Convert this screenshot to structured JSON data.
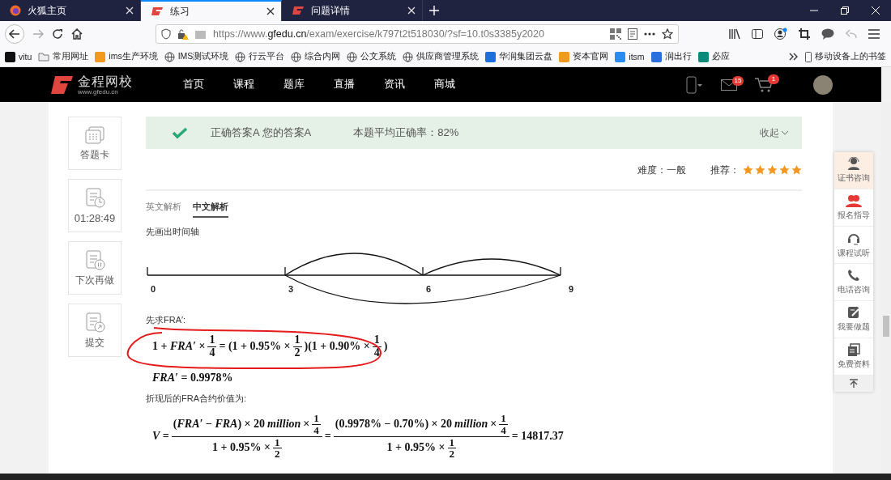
{
  "browser": {
    "tabs": [
      {
        "title": "火狐主页",
        "kind": "firefox",
        "selected": false
      },
      {
        "title": "练习",
        "kind": "site",
        "selected": true
      },
      {
        "title": "问题详情",
        "kind": "site",
        "selected": false
      }
    ],
    "url": {
      "scheme": "https://www.",
      "domain": "gfedu.cn",
      "path": "/exam/exercise/k797t2t518030/?sf=10.t0s3385y2020"
    },
    "bookmarks": [
      {
        "label": "vitu",
        "kind": "logo",
        "color": "#111111"
      },
      {
        "label": "常用网址",
        "kind": "folder"
      },
      {
        "label": "ims生产环境",
        "kind": "logo",
        "color": "#f39a1e"
      },
      {
        "label": "IMS测试环境",
        "kind": "globe"
      },
      {
        "label": "行云平台",
        "kind": "globe"
      },
      {
        "label": "综合内网",
        "kind": "globe"
      },
      {
        "label": "公文系统",
        "kind": "globe"
      },
      {
        "label": "供应商管理系统",
        "kind": "globe"
      },
      {
        "label": "华润集团云盘",
        "kind": "logo",
        "color": "#1e6fd9"
      },
      {
        "label": "资本官网",
        "kind": "logo",
        "color": "#f39a1e"
      },
      {
        "label": "itsm",
        "kind": "logo",
        "color": "#2a8cf0"
      },
      {
        "label": "润出行",
        "kind": "logo",
        "color": "#2a6fe0"
      },
      {
        "label": "必应",
        "kind": "logo",
        "color": "#0b8a7a"
      }
    ],
    "mobile_bookmarks": "移动设备上的书签"
  },
  "site": {
    "logo_name": "金程网校",
    "logo_url": "www.gfedu.cn",
    "nav": [
      "首页",
      "课程",
      "题库",
      "直播",
      "资讯",
      "商城"
    ],
    "mail_count": "15",
    "cart_count": "1"
  },
  "tools": [
    {
      "label": "答题卡",
      "kind": "card"
    },
    {
      "label": "01:28:49",
      "kind": "timer"
    },
    {
      "label": "下次再做",
      "kind": "pause"
    },
    {
      "label": "提交",
      "kind": "submit"
    }
  ],
  "result": {
    "correct": true,
    "answer": "正确答案A 您的答案A",
    "average": "本题平均正确率：82%",
    "collapse": "收起"
  },
  "rating": {
    "difficulty": "难度：一般",
    "recommend": "推荐：",
    "stars": 5
  },
  "analysis_tabs": [
    {
      "label": "英文解析",
      "selected": false
    },
    {
      "label": "中文解析",
      "selected": true
    }
  ],
  "explanation": [
    {
      "kind": "text",
      "text": "先画出时间轴"
    },
    {
      "kind": "timeline",
      "labels": [
        "0",
        "3",
        "6",
        "9"
      ]
    },
    {
      "kind": "text",
      "text": "先求FRA′:"
    },
    {
      "kind": "formula",
      "highlighted": true,
      "parts": [
        {
          "kind": "text",
          "text": "1 + *FRA′* ×"
        },
        {
          "kind": "frac",
          "num": [
            {
              "kind": "text",
              "text": "1"
            }
          ],
          "den": [
            {
              "kind": "text",
              "text": "4"
            }
          ]
        },
        {
          "kind": "text",
          "text": "= (1 + 0.95% ×"
        },
        {
          "kind": "frac",
          "num": [
            {
              "kind": "text",
              "text": "1"
            }
          ],
          "den": [
            {
              "kind": "text",
              "text": "2"
            }
          ]
        },
        {
          "kind": "text",
          "text": ")(1 + 0.90% ×"
        },
        {
          "kind": "frac",
          "num": [
            {
              "kind": "text",
              "text": "1"
            }
          ],
          "den": [
            {
              "kind": "text",
              "text": "4"
            }
          ]
        },
        {
          "kind": "text",
          "text": ")"
        }
      ]
    },
    {
      "kind": "formula",
      "highlighted": false,
      "parts": [
        {
          "kind": "text",
          "text": "*FRA′* = 0.9978%"
        }
      ]
    },
    {
      "kind": "text",
      "text": "折现后的FRA合约价值为:"
    },
    {
      "kind": "formula",
      "highlighted": false,
      "parts": [
        {
          "kind": "text",
          "text": "*V* ="
        },
        {
          "kind": "frac",
          "num": [
            {
              "kind": "text",
              "text": "(*FRA′* − *FRA*) × 20"
            },
            {
              "kind": "text",
              "text": "*million*"
            },
            {
              "kind": "text",
              "text": "×"
            },
            {
              "kind": "frac",
              "num": [
                {
                  "kind": "text",
                  "text": "1"
                }
              ],
              "den": [
                {
                  "kind": "text",
                  "text": "4"
                }
              ]
            }
          ],
          "den": [
            {
              "kind": "text",
              "text": "1 + 0.95% ×"
            },
            {
              "kind": "frac",
              "num": [
                {
                  "kind": "text",
                  "text": "1"
                }
              ],
              "den": [
                {
                  "kind": "text",
                  "text": "2"
                }
              ]
            }
          ]
        },
        {
          "kind": "text",
          "text": "="
        },
        {
          "kind": "frac",
          "num": [
            {
              "kind": "text",
              "text": "(0.9978% − 0.70%) × 20"
            },
            {
              "kind": "text",
              "text": "*million*"
            },
            {
              "kind": "text",
              "text": "×"
            },
            {
              "kind": "frac",
              "num": [
                {
                  "kind": "text",
                  "text": "1"
                }
              ],
              "den": [
                {
                  "kind": "text",
                  "text": "4"
                }
              ]
            }
          ],
          "den": [
            {
              "kind": "text",
              "text": "1 + 0.95% ×"
            },
            {
              "kind": "frac",
              "num": [
                {
                  "kind": "text",
                  "text": "1"
                }
              ],
              "den": [
                {
                  "kind": "text",
                  "text": "2"
                }
              ]
            }
          ]
        },
        {
          "kind": "text",
          "text": "= 14817.37"
        }
      ]
    }
  ],
  "side_panel": {
    "items": [
      {
        "label": "证书咨询",
        "kind": "agent",
        "selected": true
      },
      {
        "label": "报名指导",
        "kind": "people",
        "selected": false
      },
      {
        "label": "课程试听",
        "kind": "headset",
        "selected": false
      },
      {
        "label": "电话咨询",
        "kind": "phone",
        "selected": false
      },
      {
        "label": "我要做题",
        "kind": "edit",
        "selected": false
      },
      {
        "label": "免费资料",
        "kind": "docs",
        "selected": false
      }
    ]
  }
}
